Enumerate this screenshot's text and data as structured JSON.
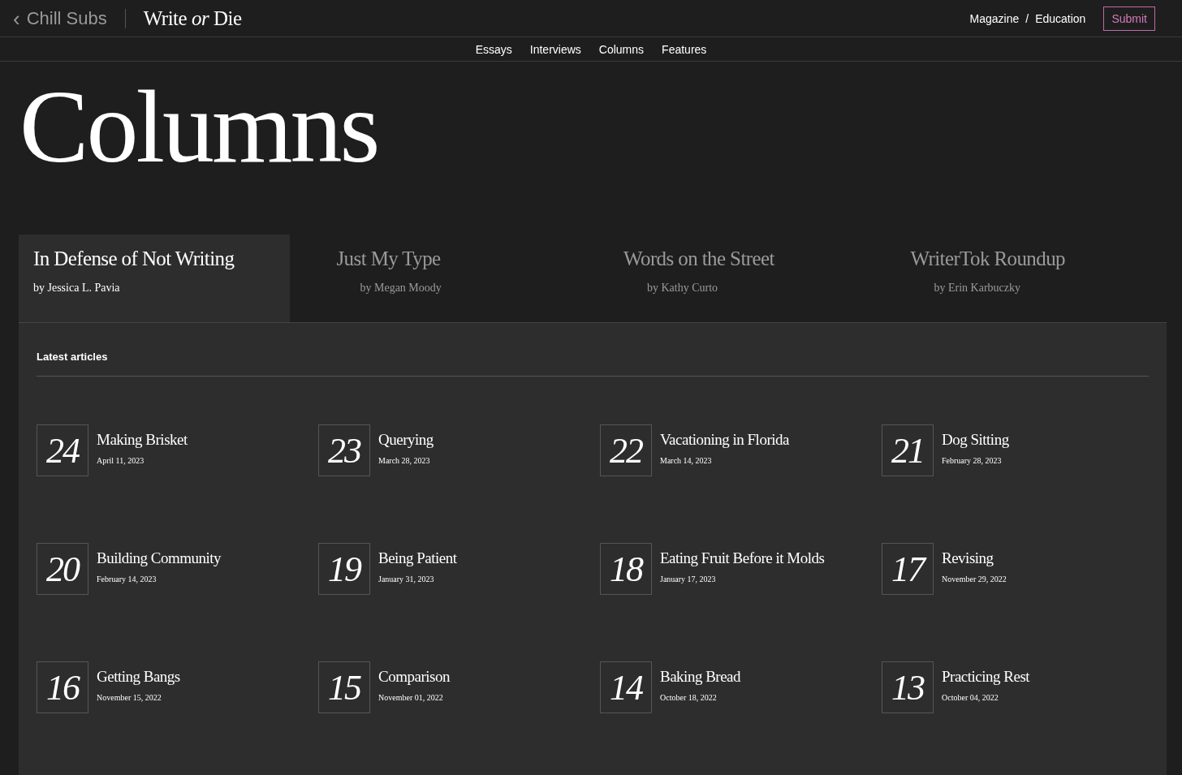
{
  "header": {
    "back_glyph": "‹",
    "brand": "Chill Subs",
    "logo": "Write *or* Die",
    "breadcrumb": [
      "Magazine",
      "/",
      "Education"
    ],
    "submit": "Submit"
  },
  "subnav": [
    {
      "label": "Essays"
    },
    {
      "label": "Interviews"
    },
    {
      "label": "Columns"
    },
    {
      "label": "Features"
    }
  ],
  "page_title": "Columns",
  "column_tabs": [
    {
      "title": "In Defense of Not Writing",
      "byline": "by Jessica L. Pavia",
      "selected": true
    },
    {
      "title": "Just My Type",
      "byline": "by Megan Moody",
      "selected": false
    },
    {
      "title": "Words on the Street",
      "byline": "by Kathy Curto",
      "selected": false
    },
    {
      "title": "WriterTok Roundup",
      "byline": "by Erin Karbuczky",
      "selected": false
    }
  ],
  "latest": {
    "heading": "Latest articles",
    "articles": [
      {
        "number": "24",
        "title": "Making Brisket",
        "date": "April 11, 2023"
      },
      {
        "number": "23",
        "title": "Querying",
        "date": "March 28, 2023"
      },
      {
        "number": "22",
        "title": "Vacationing in Florida",
        "date": "March 14, 2023"
      },
      {
        "number": "21",
        "title": "Dog Sitting",
        "date": "February 28, 2023"
      },
      {
        "number": "20",
        "title": "Building Community",
        "date": "February 14, 2023"
      },
      {
        "number": "19",
        "title": "Being Patient",
        "date": "January 31, 2023"
      },
      {
        "number": "18",
        "title": "Eating Fruit Before it Molds",
        "date": "January 17, 2023"
      },
      {
        "number": "17",
        "title": "Revising",
        "date": "November 29, 2022"
      },
      {
        "number": "16",
        "title": "Getting Bangs",
        "date": "November 15, 2022"
      },
      {
        "number": "15",
        "title": "Comparison",
        "date": "November 01, 2022"
      },
      {
        "number": "14",
        "title": "Baking Bread",
        "date": "October 18, 2022"
      },
      {
        "number": "13",
        "title": "Practicing Rest",
        "date": "October 04, 2022"
      }
    ]
  }
}
